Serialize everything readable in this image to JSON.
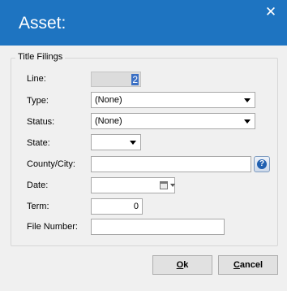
{
  "window": {
    "title": "Asset:",
    "close_glyph": "✕"
  },
  "group": {
    "title": "Title Filings"
  },
  "form": {
    "line_label": "Line:",
    "line_value": "2",
    "type_label": "Type:",
    "type_value": "(None)",
    "status_label": "Status:",
    "status_value": "(None)",
    "state_label": "State:",
    "state_value": "",
    "county_label": "County/City:",
    "county_value": "",
    "date_label": "Date:",
    "date_value": "",
    "term_label": "Term:",
    "term_value": "0",
    "file_number_label": "File Number:",
    "file_number_value": ""
  },
  "icons": {
    "help": "help-icon",
    "calendar": "calendar-icon"
  },
  "buttons": {
    "ok_first": "O",
    "ok_rest": "k",
    "cancel_first": "C",
    "cancel_rest": "ancel"
  },
  "colors": {
    "titlebar": "#1e74c1",
    "background": "#f0f0f0"
  }
}
